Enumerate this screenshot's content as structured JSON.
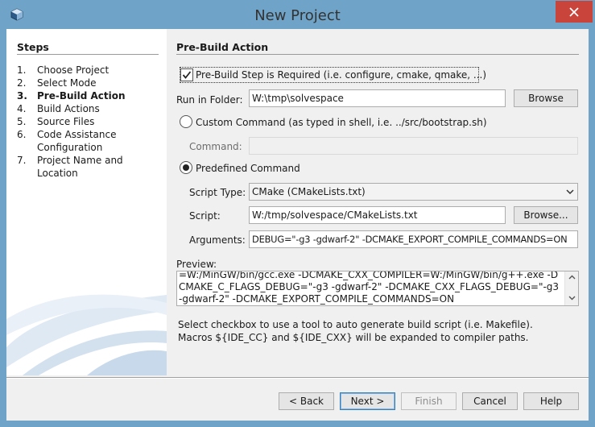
{
  "window": {
    "title": "New Project"
  },
  "steps": {
    "title": "Steps",
    "items": [
      {
        "num": "1.",
        "label": "Choose Project"
      },
      {
        "num": "2.",
        "label": "Select Mode"
      },
      {
        "num": "3.",
        "label": "Pre-Build Action"
      },
      {
        "num": "4.",
        "label": "Build Actions"
      },
      {
        "num": "5.",
        "label": "Source Files"
      },
      {
        "num": "6.",
        "label": "Code Assistance Configuration"
      },
      {
        "num": "7.",
        "label": "Project Name and Location"
      }
    ],
    "current_index": 2
  },
  "main": {
    "title": "Pre-Build Action",
    "prebuild_checkbox": {
      "label": "Pre-Build Step is Required (i.e. configure, cmake, qmake, ...)",
      "checked": true
    },
    "run_in_folder": {
      "label": "Run in Folder:",
      "value": "W:\\tmp\\solvespace",
      "button": "Browse"
    },
    "custom_command": {
      "label": "Custom Command (as typed in shell, i.e. ../src/bootstrap.sh)",
      "selected": false
    },
    "command": {
      "label": "Command:",
      "value": ""
    },
    "predefined_command": {
      "label": "Predefined Command",
      "selected": true
    },
    "script_type": {
      "label": "Script Type:",
      "value": "CMake (CMakeLists.txt)"
    },
    "script": {
      "label": "Script:",
      "value": "W:/tmp/solvespace/CMakeLists.txt",
      "button": "Browse..."
    },
    "arguments": {
      "label": "Arguments:",
      "value": "DEBUG=\"-g3 -gdwarf-2\" -DCMAKE_EXPORT_COMPILE_COMMANDS=ON"
    },
    "preview": {
      "label": "Preview:",
      "text": "=W:/MinGW/bin/gcc.exe -DCMAKE_CXX_COMPILER=W:/MinGW/bin/g++.exe -DCMAKE_C_FLAGS_DEBUG=\"-g3 -gdwarf-2\" -DCMAKE_CXX_FLAGS_DEBUG=\"-g3 -gdwarf-2\" -DCMAKE_EXPORT_COMPILE_COMMANDS=ON"
    },
    "info_line1": "Select checkbox to use a tool to auto generate build script (i.e. Makefile).",
    "info_line2": "Macros ${IDE_CC} and ${IDE_CXX} will be expanded to compiler paths."
  },
  "buttons": {
    "back": "< Back",
    "next": "Next >",
    "finish": "Finish",
    "cancel": "Cancel",
    "help": "Help"
  }
}
